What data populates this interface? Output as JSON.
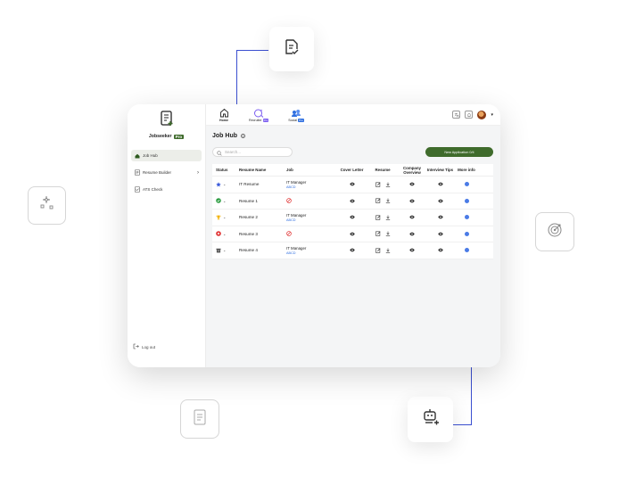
{
  "sidebar": {
    "brand": {
      "name": "Jobseeker",
      "badge": "Pro"
    },
    "items": [
      {
        "label": "Job Hub",
        "active": true,
        "icon": "home-icon"
      },
      {
        "label": "Resume Builder",
        "active": false,
        "icon": "document-icon",
        "has_chevron": true
      },
      {
        "label": "ATS Check",
        "active": false,
        "icon": "check-document-icon"
      }
    ],
    "logout_label": "Log out"
  },
  "topbar": {
    "tabs": [
      {
        "label": "Home",
        "icon": "home-icon"
      },
      {
        "label": "Recruiter",
        "badge": "Pro",
        "icon": "magnifier-sparkle-icon"
      },
      {
        "label": "Social",
        "badge": "Pro",
        "icon": "people-icon"
      }
    ]
  },
  "main": {
    "title": "Job Hub",
    "search_placeholder": "Search...",
    "primary_button": "New Application 0/4"
  },
  "table": {
    "columns": [
      "Status",
      "Resume Name",
      "Job",
      "Cover Letter",
      "Resume",
      "Company Overview",
      "Interview Tips",
      "More info"
    ],
    "rows": [
      {
        "status": "star",
        "name": "IT Resume",
        "job_title": "IT Manager",
        "job_company": "ABCD",
        "cover": "view"
      },
      {
        "status": "check",
        "name": "Resume 1",
        "job_title": "",
        "job_company": "",
        "cover": "none"
      },
      {
        "status": "trophy",
        "name": "Resume 2",
        "job_title": "IT Manager",
        "job_company": "ABCD",
        "cover": "view"
      },
      {
        "status": "cross",
        "name": "Resume 3",
        "job_title": "",
        "job_company": "",
        "cover": "none"
      },
      {
        "status": "archive",
        "name": "Resume 4",
        "job_title": "IT Manager",
        "job_company": "ABCD",
        "cover": "view"
      }
    ]
  },
  "colors": {
    "accent": "#3f6b2c",
    "link": "#2f6fe0",
    "connector": "#3b4fd0"
  }
}
